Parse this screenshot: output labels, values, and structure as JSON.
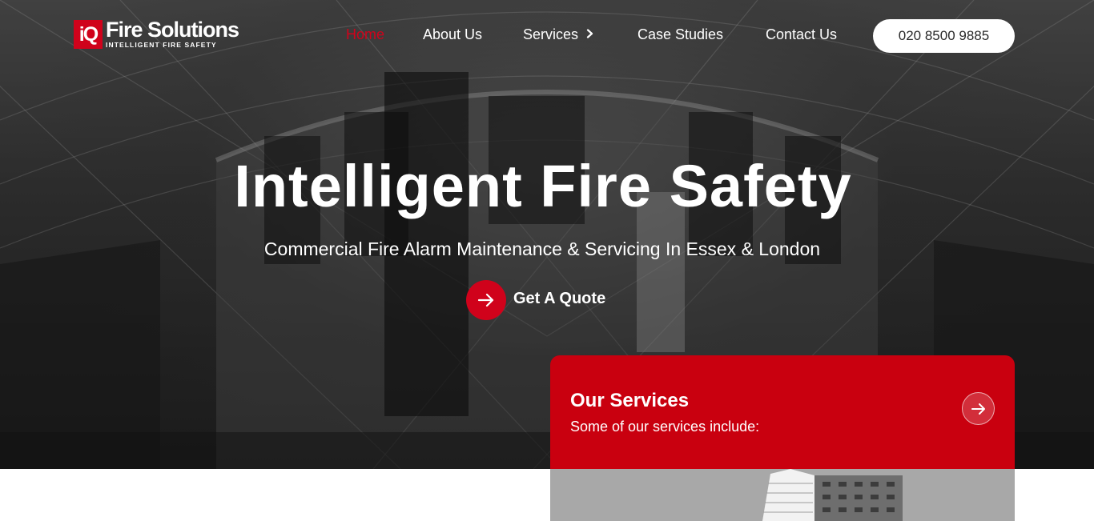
{
  "brand": {
    "mark": "iQ",
    "name": "Fire Solutions",
    "tagline": "INTELLIGENT FIRE SAFETY",
    "accent": "#d0021b"
  },
  "nav": {
    "items": [
      {
        "label": "Home",
        "active": true
      },
      {
        "label": "About Us"
      },
      {
        "label": "Services",
        "icon": "chevron-right-icon"
      },
      {
        "label": "Case Studies"
      },
      {
        "label": "Contact Us"
      }
    ],
    "phone": "020 8500 9885"
  },
  "hero": {
    "title": "Intelligent Fire Safety",
    "subtitle": "Commercial Fire Alarm Maintenance & Servicing In Essex & London",
    "cta_label": "Get A Quote",
    "cta_icon": "arrow-right-icon",
    "background": "greyscale photo of a glass-roofed atrium"
  },
  "services_card": {
    "title": "Our Services",
    "subtitle": "Some of our services include:",
    "icon": "arrow-right-icon",
    "color": "#c9000f"
  }
}
